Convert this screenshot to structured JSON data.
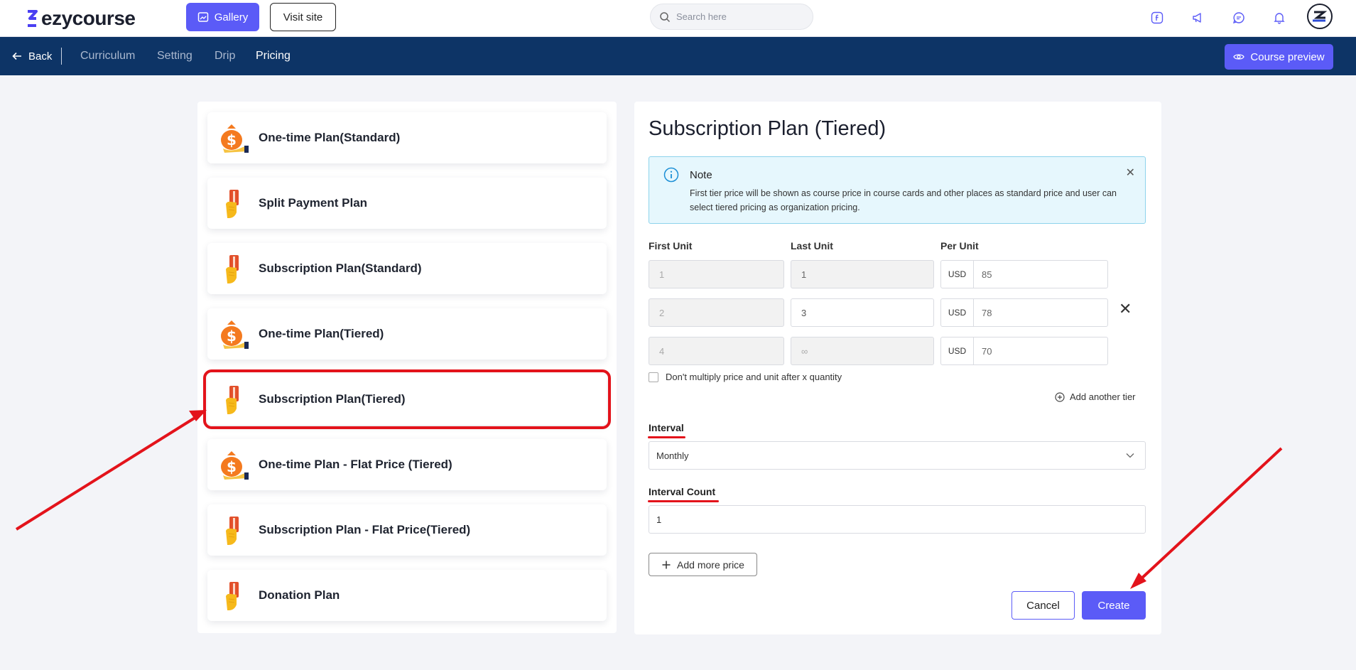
{
  "brand": {
    "name": "ezycourse",
    "accent": "#5b5bf7",
    "nav_bg": "#0d3466",
    "highlight": "#e3131b"
  },
  "topbar": {
    "gallery_label": "Gallery",
    "visit_label": "Visit site",
    "search_placeholder": "Search here",
    "icons": [
      "facebook-icon",
      "megaphone-icon",
      "chat-icon",
      "bell-icon",
      "avatar"
    ]
  },
  "nav": {
    "back_label": "Back",
    "tabs": [
      "Curriculum",
      "Setting",
      "Drip",
      "Pricing"
    ],
    "active_tab": "Pricing",
    "preview_label": "Course preview"
  },
  "plans": [
    {
      "label": "One-time Plan(Standard)",
      "icon": "money-bag-icon"
    },
    {
      "label": "Split Payment Plan",
      "icon": "card-hand-icon"
    },
    {
      "label": "Subscription Plan(Standard)",
      "icon": "card-hand-icon"
    },
    {
      "label": "One-time Plan(Tiered)",
      "icon": "money-bag-icon"
    },
    {
      "label": "Subscription Plan(Tiered)",
      "icon": "card-hand-icon",
      "selected": true
    },
    {
      "label": "One-time Plan - Flat Price (Tiered)",
      "icon": "money-bag-icon"
    },
    {
      "label": "Subscription Plan - Flat Price(Tiered)",
      "icon": "card-hand-icon"
    },
    {
      "label": "Donation Plan",
      "icon": "card-hand-icon"
    }
  ],
  "form": {
    "title": "Subscription Plan (Tiered)",
    "note": {
      "title": "Note",
      "text": "First tier price will be shown as course price in course cards and other places as standard price and user can select tiered pricing as organization pricing."
    },
    "columns": {
      "first": "First Unit",
      "last": "Last Unit",
      "per": "Per Unit"
    },
    "tiers": [
      {
        "first": "1",
        "last": "1",
        "currency": "USD",
        "price": "85"
      },
      {
        "first": "2",
        "last": "3",
        "currency": "USD",
        "price": "78"
      },
      {
        "first": "4",
        "last": "∞",
        "currency": "USD",
        "price": "70"
      }
    ],
    "no_multiply_label": "Don't multiply price and unit after x quantity",
    "add_tier_label": "Add another tier",
    "interval_label": "Interval",
    "interval_value": "Monthly",
    "interval_count_label": "Interval Count",
    "interval_count_value": "1",
    "add_price_label": "Add more price",
    "cancel_label": "Cancel",
    "create_label": "Create"
  }
}
